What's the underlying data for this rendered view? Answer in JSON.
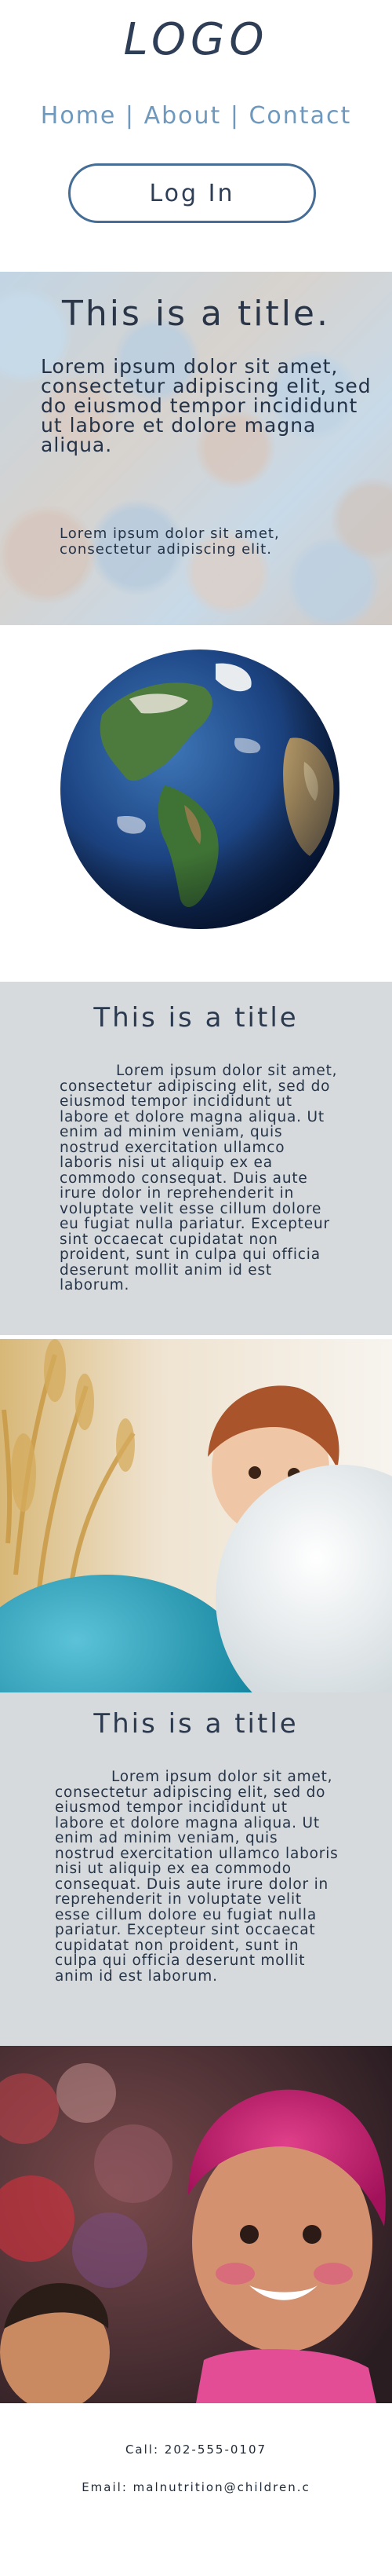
{
  "header": {
    "logo": "LOGO",
    "nav": {
      "home": "Home",
      "separator": "|",
      "about": "About",
      "contact": "Contact"
    },
    "login_label": "Log In"
  },
  "hero": {
    "title": "This is a title.",
    "text": "Lorem ipsum dolor sit amet, consectetur adipiscing elit,  sed do eiusmod tempor incididunt ut labore et dolore  magna aliqua.",
    "small_text": "Lorem ipsum dolor sit amet, consectetur adipiscing elit."
  },
  "section1": {
    "title": "This is a title",
    "body": "Lorem ipsum dolor sit amet, consectetur adipiscing elit, sed do eiusmod tempor incididunt ut labore et dolore magna aliqua. Ut enim ad minim veniam, quis nostrud exercitation ullamco laboris nisi ut aliquip ex ea commodo consequat. Duis aute irure dolor in reprehenderit in voluptate velit esse cillum dolore eu fugiat nulla pariatur. Excepteur sint occaecat cupidatat non proident, sunt in culpa qui officia deserunt mollit anim id est laborum."
  },
  "section2": {
    "title": "This is a title",
    "body": "Lorem ipsum dolor sit amet, consectetur adipiscing elit, sed do eiusmod tempor incididunt ut labore et dolore magna aliqua. Ut enim ad minim veniam, quis nostrud exercitation ullamco laboris nisi ut aliquip ex ea commodo consequat. Duis aute irure dolor in reprehenderit in voluptate velit esse cillum dolore eu fugiat nulla pariatur. Excepteur sint occaecat cupidatat non proident, sunt in culpa qui officia deserunt mollit anim id est laborum."
  },
  "footer": {
    "call": "Call: 202-555-0107",
    "email": "Email: malnutrition@children.c"
  },
  "colors": {
    "nav": "#6f98bd",
    "login_border": "#456d95",
    "section_bg": "#d7dadd",
    "text_dark": "#2c3a4f"
  },
  "icons": {
    "globe": "earth-globe-image",
    "photo1": "child-with-balloons-photo",
    "photo2": "child-with-holi-colors-photo",
    "hero_bg": "crowd-of-children-photo"
  }
}
